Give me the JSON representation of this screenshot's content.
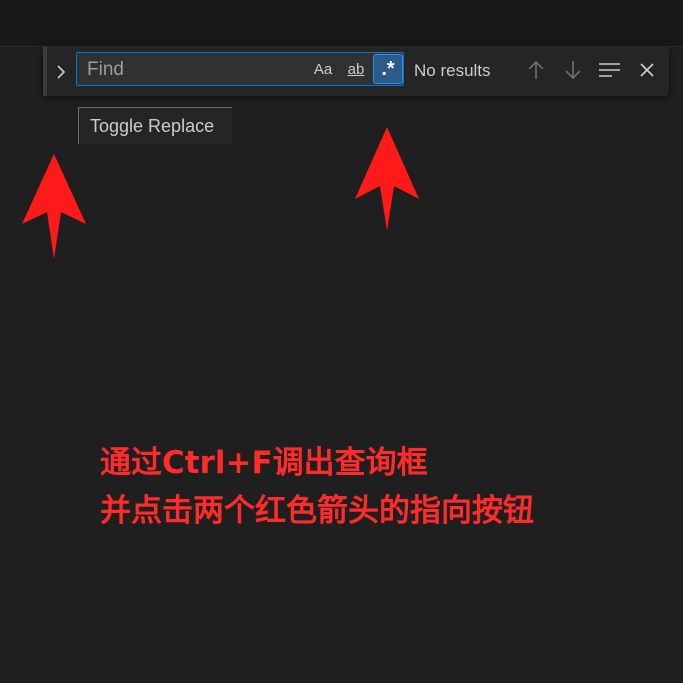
{
  "find_widget": {
    "toggle_replace_glyph": "›",
    "input_placeholder": "Find",
    "match_case_label": "Aa",
    "whole_word_label": "ab",
    "regex_label": ".*",
    "results_text": "No results"
  },
  "tooltip": {
    "text": "Toggle Replace"
  },
  "annotation": {
    "line1": "通过Ctrl+F调出查询框",
    "line2": "并点击两个红色箭头的指向按钮"
  },
  "colors": {
    "accent_border": "#0078d4",
    "regex_active_bg": "#2b5b8a",
    "annotation_red": "#ff2a2a"
  },
  "icons": [
    "chevron-right-icon",
    "arrow-up-icon",
    "arrow-down-icon",
    "selection-lines-icon",
    "close-icon"
  ]
}
